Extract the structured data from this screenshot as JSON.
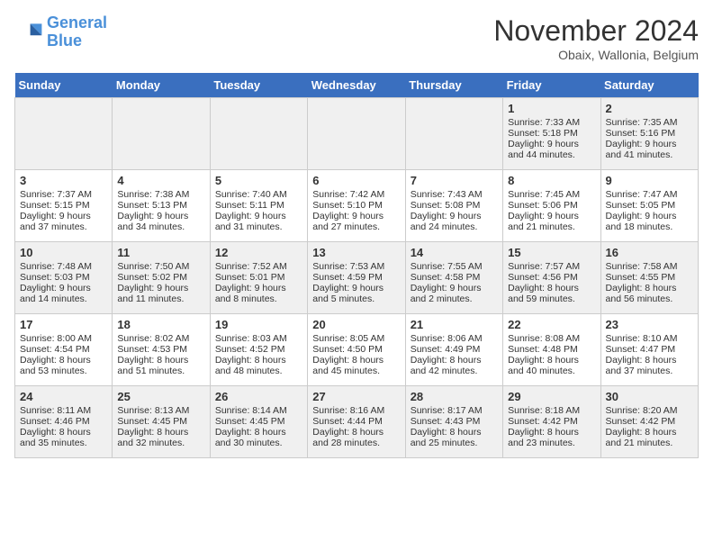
{
  "header": {
    "logo_line1": "General",
    "logo_line2": "Blue",
    "month": "November 2024",
    "location": "Obaix, Wallonia, Belgium"
  },
  "days_of_week": [
    "Sunday",
    "Monday",
    "Tuesday",
    "Wednesday",
    "Thursday",
    "Friday",
    "Saturday"
  ],
  "weeks": [
    [
      {
        "day": "",
        "data": ""
      },
      {
        "day": "",
        "data": ""
      },
      {
        "day": "",
        "data": ""
      },
      {
        "day": "",
        "data": ""
      },
      {
        "day": "",
        "data": ""
      },
      {
        "day": "1",
        "data": "Sunrise: 7:33 AM\nSunset: 5:18 PM\nDaylight: 9 hours and 44 minutes."
      },
      {
        "day": "2",
        "data": "Sunrise: 7:35 AM\nSunset: 5:16 PM\nDaylight: 9 hours and 41 minutes."
      }
    ],
    [
      {
        "day": "3",
        "data": "Sunrise: 7:37 AM\nSunset: 5:15 PM\nDaylight: 9 hours and 37 minutes."
      },
      {
        "day": "4",
        "data": "Sunrise: 7:38 AM\nSunset: 5:13 PM\nDaylight: 9 hours and 34 minutes."
      },
      {
        "day": "5",
        "data": "Sunrise: 7:40 AM\nSunset: 5:11 PM\nDaylight: 9 hours and 31 minutes."
      },
      {
        "day": "6",
        "data": "Sunrise: 7:42 AM\nSunset: 5:10 PM\nDaylight: 9 hours and 27 minutes."
      },
      {
        "day": "7",
        "data": "Sunrise: 7:43 AM\nSunset: 5:08 PM\nDaylight: 9 hours and 24 minutes."
      },
      {
        "day": "8",
        "data": "Sunrise: 7:45 AM\nSunset: 5:06 PM\nDaylight: 9 hours and 21 minutes."
      },
      {
        "day": "9",
        "data": "Sunrise: 7:47 AM\nSunset: 5:05 PM\nDaylight: 9 hours and 18 minutes."
      }
    ],
    [
      {
        "day": "10",
        "data": "Sunrise: 7:48 AM\nSunset: 5:03 PM\nDaylight: 9 hours and 14 minutes."
      },
      {
        "day": "11",
        "data": "Sunrise: 7:50 AM\nSunset: 5:02 PM\nDaylight: 9 hours and 11 minutes."
      },
      {
        "day": "12",
        "data": "Sunrise: 7:52 AM\nSunset: 5:01 PM\nDaylight: 9 hours and 8 minutes."
      },
      {
        "day": "13",
        "data": "Sunrise: 7:53 AM\nSunset: 4:59 PM\nDaylight: 9 hours and 5 minutes."
      },
      {
        "day": "14",
        "data": "Sunrise: 7:55 AM\nSunset: 4:58 PM\nDaylight: 9 hours and 2 minutes."
      },
      {
        "day": "15",
        "data": "Sunrise: 7:57 AM\nSunset: 4:56 PM\nDaylight: 8 hours and 59 minutes."
      },
      {
        "day": "16",
        "data": "Sunrise: 7:58 AM\nSunset: 4:55 PM\nDaylight: 8 hours and 56 minutes."
      }
    ],
    [
      {
        "day": "17",
        "data": "Sunrise: 8:00 AM\nSunset: 4:54 PM\nDaylight: 8 hours and 53 minutes."
      },
      {
        "day": "18",
        "data": "Sunrise: 8:02 AM\nSunset: 4:53 PM\nDaylight: 8 hours and 51 minutes."
      },
      {
        "day": "19",
        "data": "Sunrise: 8:03 AM\nSunset: 4:52 PM\nDaylight: 8 hours and 48 minutes."
      },
      {
        "day": "20",
        "data": "Sunrise: 8:05 AM\nSunset: 4:50 PM\nDaylight: 8 hours and 45 minutes."
      },
      {
        "day": "21",
        "data": "Sunrise: 8:06 AM\nSunset: 4:49 PM\nDaylight: 8 hours and 42 minutes."
      },
      {
        "day": "22",
        "data": "Sunrise: 8:08 AM\nSunset: 4:48 PM\nDaylight: 8 hours and 40 minutes."
      },
      {
        "day": "23",
        "data": "Sunrise: 8:10 AM\nSunset: 4:47 PM\nDaylight: 8 hours and 37 minutes."
      }
    ],
    [
      {
        "day": "24",
        "data": "Sunrise: 8:11 AM\nSunset: 4:46 PM\nDaylight: 8 hours and 35 minutes."
      },
      {
        "day": "25",
        "data": "Sunrise: 8:13 AM\nSunset: 4:45 PM\nDaylight: 8 hours and 32 minutes."
      },
      {
        "day": "26",
        "data": "Sunrise: 8:14 AM\nSunset: 4:45 PM\nDaylight: 8 hours and 30 minutes."
      },
      {
        "day": "27",
        "data": "Sunrise: 8:16 AM\nSunset: 4:44 PM\nDaylight: 8 hours and 28 minutes."
      },
      {
        "day": "28",
        "data": "Sunrise: 8:17 AM\nSunset: 4:43 PM\nDaylight: 8 hours and 25 minutes."
      },
      {
        "day": "29",
        "data": "Sunrise: 8:18 AM\nSunset: 4:42 PM\nDaylight: 8 hours and 23 minutes."
      },
      {
        "day": "30",
        "data": "Sunrise: 8:20 AM\nSunset: 4:42 PM\nDaylight: 8 hours and 21 minutes."
      }
    ]
  ],
  "row_styles": [
    "shaded",
    "white",
    "shaded",
    "white",
    "shaded"
  ]
}
